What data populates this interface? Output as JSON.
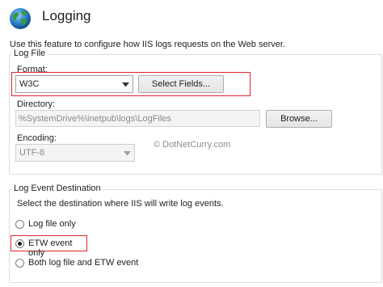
{
  "header": {
    "title": "Logging",
    "description": "Use this feature to configure how IIS logs requests on the Web server."
  },
  "log_file": {
    "group_label": "Log File",
    "format_label": "Format:",
    "format_value": "W3C",
    "select_fields_label": "Select Fields...",
    "directory_label": "Directory:",
    "directory_value": "%SystemDrive%\\inetpub\\logs\\LogFiles",
    "browse_label": "Browse...",
    "encoding_label": "Encoding:",
    "encoding_value": "UTF-8"
  },
  "watermark": "© DotNetCurry.com",
  "log_event": {
    "group_label": "Log Event Destination",
    "instruction": "Select the destination where IIS will write log events.",
    "options": [
      {
        "label": "Log file only",
        "checked": false
      },
      {
        "label": "ETW event only",
        "checked": true
      },
      {
        "label": "Both log file and ETW event",
        "checked": false
      }
    ]
  },
  "colors": {
    "highlight": "#e0242c",
    "group_border": "#d5dfe5"
  }
}
